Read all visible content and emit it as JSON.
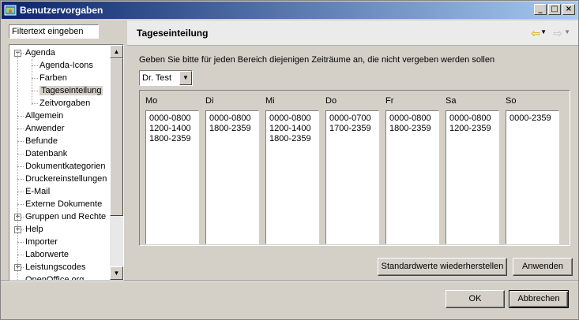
{
  "window": {
    "title": "Benutzervorgaben",
    "minimize": "_",
    "maximize": "□",
    "close": "×"
  },
  "filter": {
    "value": "Filtertext eingeben"
  },
  "tree": {
    "items": [
      {
        "label": "Agenda",
        "level": 0,
        "expander": "−"
      },
      {
        "label": "Agenda-Icons",
        "level": 1
      },
      {
        "label": "Farben",
        "level": 1
      },
      {
        "label": "Tageseinteilung",
        "level": 1,
        "selected": true
      },
      {
        "label": "Zeitvorgaben",
        "level": 1
      },
      {
        "label": "Allgemein",
        "level": 0
      },
      {
        "label": "Anwender",
        "level": 0
      },
      {
        "label": "Befunde",
        "level": 0
      },
      {
        "label": "Datenbank",
        "level": 0
      },
      {
        "label": "Dokumentkategorien",
        "level": 0
      },
      {
        "label": "Druckereinstellungen",
        "level": 0
      },
      {
        "label": "E-Mail",
        "level": 0
      },
      {
        "label": "Externe Dokumente",
        "level": 0
      },
      {
        "label": "Gruppen und Rechte",
        "level": 0,
        "expander": "+"
      },
      {
        "label": "Help",
        "level": 0,
        "expander": "+"
      },
      {
        "label": "Importer",
        "level": 0
      },
      {
        "label": "Laborwerte",
        "level": 0
      },
      {
        "label": "Leistungscodes",
        "level": 0,
        "expander": "+"
      },
      {
        "label": "OpenOffice.org",
        "level": 0
      }
    ]
  },
  "page": {
    "title": "Tageseinteilung",
    "instruction": "Geben Sie bitte für jeden Bereich diejenigen Zeiträume an, die nicht vergeben werden sollen",
    "area_select": "Dr. Test",
    "days": [
      {
        "label": "Mo",
        "ranges": "0000-0800\n1200-1400\n1800-2359"
      },
      {
        "label": "Di",
        "ranges": "0000-0800\n1800-2359"
      },
      {
        "label": "Mi",
        "ranges": "0000-0800\n1200-1400\n1800-2359"
      },
      {
        "label": "Do",
        "ranges": "0000-0700\n1700-2359"
      },
      {
        "label": "Fr",
        "ranges": "0000-0800\n1800-2359"
      },
      {
        "label": "Sa",
        "ranges": "0000-0800\n1200-2359"
      },
      {
        "label": "So",
        "ranges": "0000-2359"
      }
    ],
    "restore_defaults": "Standardwerte wiederherstellen",
    "apply": "Anwenden"
  },
  "footer": {
    "ok": "OK",
    "cancel": "Abbrechen"
  },
  "colors": {
    "title_start": "#0a246a",
    "title_end": "#a6caf0",
    "face": "#d4d0c8",
    "nav_back": "#e0a000"
  }
}
